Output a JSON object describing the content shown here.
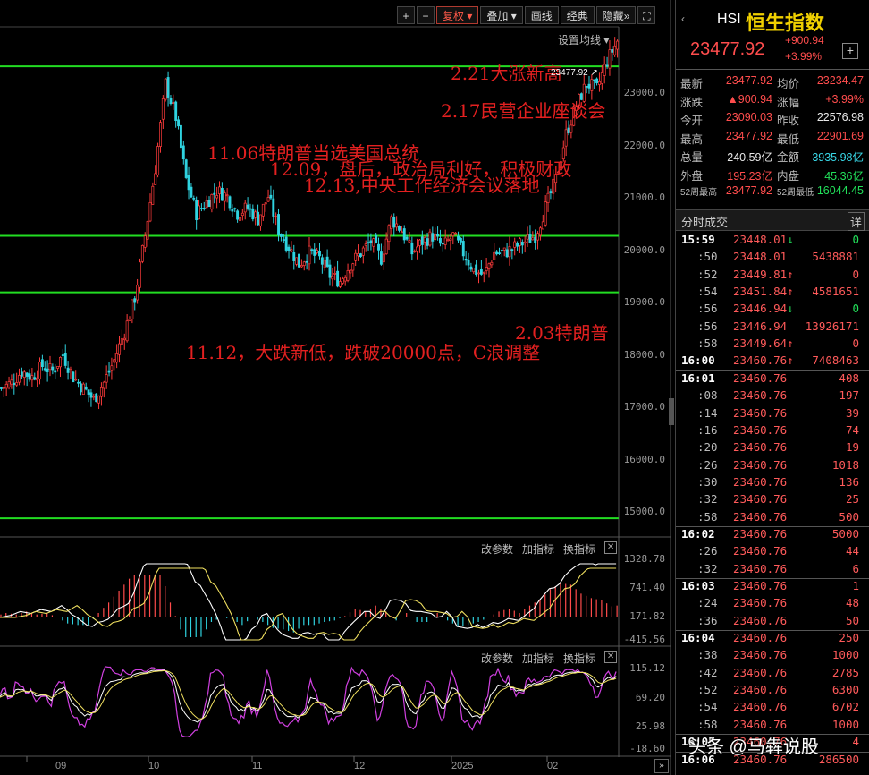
{
  "toolbar": {
    "buttons": [
      "+",
      "−",
      "复权",
      "叠加",
      "画线",
      "经典",
      "隐藏»",
      "⛶"
    ],
    "active_index": 2,
    "dropdown_indices": [
      2,
      3
    ],
    "set_ma": "设置均线"
  },
  "annotations": [
    {
      "text": "2.21大涨新高"
    },
    {
      "text": "2.17民营企业座谈会"
    },
    {
      "text": "11.06特朗普当选美国总统"
    },
    {
      "text": "12.09，盘后，政治局利好，积极财政"
    },
    {
      "text": "12.13,中央工作经济会议落地"
    },
    {
      "text": "2.03特朗普"
    },
    {
      "text": "11.12，大跌新低，跌破20000点，C浪调整"
    }
  ],
  "price_tag": "23477.92",
  "main_axis": [
    "23000.0",
    "22000.0",
    "21000.0",
    "20000.0",
    "19000.0",
    "18000.0",
    "17000.0",
    "16000.0",
    "15000.0"
  ],
  "macd_axis": [
    "1328.78",
    "741.40",
    "171.82",
    "-415.56"
  ],
  "kdj_axis": [
    "115.12",
    "69.20",
    "25.98",
    "-18.60"
  ],
  "indicator_buttons": [
    "改参数",
    "加指标",
    "换指标"
  ],
  "x_labels": [
    "09",
    "10",
    "11",
    "12",
    "2025",
    "02"
  ],
  "chart_data": {
    "type": "candlestick",
    "ylim": [
      14700,
      23700
    ],
    "hlines": [
      23000,
      20000,
      19000,
      15000
    ],
    "close_path": [
      [
        0,
        17300
      ],
      [
        4,
        17400
      ],
      [
        8,
        17600
      ],
      [
        12,
        17500
      ],
      [
        16,
        17700
      ],
      [
        20,
        17600
      ],
      [
        24,
        17900
      ],
      [
        28,
        17500
      ],
      [
        32,
        17300
      ],
      [
        36,
        17100
      ],
      [
        40,
        17400
      ],
      [
        44,
        17800
      ],
      [
        48,
        18300
      ],
      [
        52,
        18900
      ],
      [
        56,
        20000
      ],
      [
        60,
        21200
      ],
      [
        64,
        22700
      ],
      [
        68,
        22100
      ],
      [
        72,
        21000
      ],
      [
        76,
        20400
      ],
      [
        80,
        20600
      ],
      [
        84,
        20800
      ],
      [
        88,
        20700
      ],
      [
        92,
        20400
      ],
      [
        96,
        20500
      ],
      [
        100,
        20300
      ],
      [
        104,
        20700
      ],
      [
        108,
        20100
      ],
      [
        112,
        19800
      ],
      [
        116,
        19500
      ],
      [
        120,
        19700
      ],
      [
        124,
        19600
      ],
      [
        128,
        19300
      ],
      [
        132,
        19200
      ],
      [
        136,
        19500
      ],
      [
        140,
        19700
      ],
      [
        144,
        19900
      ],
      [
        148,
        19600
      ],
      [
        152,
        20300
      ],
      [
        156,
        20100
      ],
      [
        160,
        19700
      ],
      [
        164,
        19900
      ],
      [
        168,
        20000
      ],
      [
        172,
        19800
      ],
      [
        176,
        20000
      ],
      [
        180,
        19700
      ],
      [
        184,
        19400
      ],
      [
        188,
        19300
      ],
      [
        192,
        19700
      ],
      [
        196,
        19700
      ],
      [
        200,
        19800
      ],
      [
        204,
        19900
      ],
      [
        208,
        20000
      ],
      [
        212,
        20500
      ],
      [
        216,
        21000
      ],
      [
        220,
        21800
      ],
      [
        224,
        22300
      ],
      [
        228,
        22700
      ],
      [
        232,
        22600
      ],
      [
        236,
        23100
      ],
      [
        240,
        23450
      ]
    ]
  },
  "panel": {
    "code": "HSI",
    "name": "恒生指数",
    "price": "23477.92",
    "change": "+900.94",
    "percent": "+3.99%",
    "quote_rows": [
      [
        {
          "l": "最新",
          "v": "23477.92",
          "c": "red"
        },
        {
          "l": "均价",
          "v": "23234.47",
          "c": "red"
        }
      ],
      [
        {
          "l": "涨跌",
          "v": "▲900.94",
          "c": "red"
        },
        {
          "l": "涨幅",
          "v": "+3.99%",
          "c": "red"
        }
      ],
      [
        {
          "l": "今开",
          "v": "23090.03",
          "c": "red"
        },
        {
          "l": "昨收",
          "v": "22576.98",
          "c": "white"
        }
      ],
      [
        {
          "l": "最高",
          "v": "23477.92",
          "c": "red"
        },
        {
          "l": "最低",
          "v": "22901.69",
          "c": "red"
        }
      ],
      [
        {
          "l": "总量",
          "v": "240.59亿",
          "c": "white"
        },
        {
          "l": "金额",
          "v": "3935.98亿",
          "c": "cyan"
        }
      ],
      [
        {
          "l": "外盘",
          "v": "195.23亿",
          "c": "red"
        },
        {
          "l": "内盘",
          "v": "45.36亿",
          "c": "green"
        }
      ],
      [
        {
          "l": "52周最高",
          "v": "23477.92",
          "c": "red"
        },
        {
          "l": "52周最低",
          "v": "16044.45",
          "c": "green"
        }
      ]
    ],
    "ticks_title": "分时成交",
    "ticks_detail": "详",
    "ticks": [
      {
        "t": "15:59",
        "p": "23448.01",
        "a": "↓",
        "v": "0"
      },
      {
        "t": ":50",
        "p": "23448.01",
        "a": "",
        "v": "5438881"
      },
      {
        "t": ":52",
        "p": "23449.81",
        "a": "↑",
        "v": "0"
      },
      {
        "t": ":54",
        "p": "23451.84",
        "a": "↑",
        "v": "4581651"
      },
      {
        "t": ":56",
        "p": "23446.94",
        "a": "↓",
        "v": "0"
      },
      {
        "t": ":56",
        "p": "23446.94",
        "a": "",
        "v": "13926171"
      },
      {
        "t": ":58",
        "p": "23449.64",
        "a": "↑",
        "v": "0"
      },
      {
        "t": "16:00",
        "p": "23460.76",
        "a": "↑",
        "v": "7408463"
      },
      {
        "t": "16:01",
        "p": "23460.76",
        "a": "",
        "v": "408"
      },
      {
        "t": ":08",
        "p": "23460.76",
        "a": "",
        "v": "197"
      },
      {
        "t": ":14",
        "p": "23460.76",
        "a": "",
        "v": "39"
      },
      {
        "t": ":16",
        "p": "23460.76",
        "a": "",
        "v": "74"
      },
      {
        "t": ":20",
        "p": "23460.76",
        "a": "",
        "v": "19"
      },
      {
        "t": ":26",
        "p": "23460.76",
        "a": "",
        "v": "1018"
      },
      {
        "t": ":30",
        "p": "23460.76",
        "a": "",
        "v": "136"
      },
      {
        "t": ":32",
        "p": "23460.76",
        "a": "",
        "v": "25"
      },
      {
        "t": ":58",
        "p": "23460.76",
        "a": "",
        "v": "500"
      },
      {
        "t": "16:02",
        "p": "23460.76",
        "a": "",
        "v": "5000"
      },
      {
        "t": ":26",
        "p": "23460.76",
        "a": "",
        "v": "44"
      },
      {
        "t": ":32",
        "p": "23460.76",
        "a": "",
        "v": "6"
      },
      {
        "t": "16:03",
        "p": "23460.76",
        "a": "",
        "v": "1"
      },
      {
        "t": ":24",
        "p": "23460.76",
        "a": "",
        "v": "48"
      },
      {
        "t": ":36",
        "p": "23460.76",
        "a": "",
        "v": "50"
      },
      {
        "t": "16:04",
        "p": "23460.76",
        "a": "",
        "v": "250"
      },
      {
        "t": ":38",
        "p": "23460.76",
        "a": "",
        "v": "1000"
      },
      {
        "t": ":42",
        "p": "23460.76",
        "a": "",
        "v": "2785"
      },
      {
        "t": ":52",
        "p": "23460.76",
        "a": "",
        "v": "6300"
      },
      {
        "t": ":54",
        "p": "23460.76",
        "a": "",
        "v": "6702"
      },
      {
        "t": ":58",
        "p": "23460.76",
        "a": "",
        "v": "1000"
      },
      {
        "t": "16:05",
        "p": "23460.76",
        "a": "",
        "v": "4"
      },
      {
        "t": "16:06",
        "p": "23460.76",
        "a": "",
        "v": "286500"
      }
    ]
  },
  "watermark": "头条 @马犇说股"
}
